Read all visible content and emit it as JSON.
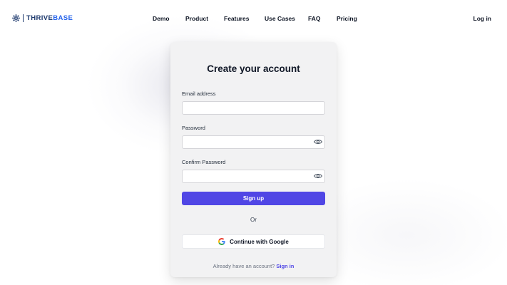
{
  "brand": {
    "name_part1": "THRIVE",
    "name_part2": "BASE",
    "primary_color": "#1e3a6e",
    "accent_color": "#2563eb"
  },
  "nav": {
    "links": [
      "Demo",
      "Product",
      "Features",
      "Use Cases",
      "FAQ",
      "Pricing"
    ],
    "login_label": "Log in"
  },
  "form": {
    "title": "Create your account",
    "email": {
      "label": "Email address",
      "value": "",
      "placeholder": ""
    },
    "password": {
      "label": "Password",
      "value": "",
      "placeholder": "",
      "toggle_icon": "eye-icon"
    },
    "confirm_password": {
      "label": "Confirm Password",
      "value": "",
      "placeholder": "",
      "toggle_icon": "eye-icon"
    },
    "submit_label": "Sign up",
    "submit_color": "#5046e5",
    "divider_text": "Or",
    "google_label": "Continue with Google",
    "google_icon": "google-icon",
    "footer_prompt": "Already have an account?",
    "signin_label": "Sign in"
  }
}
